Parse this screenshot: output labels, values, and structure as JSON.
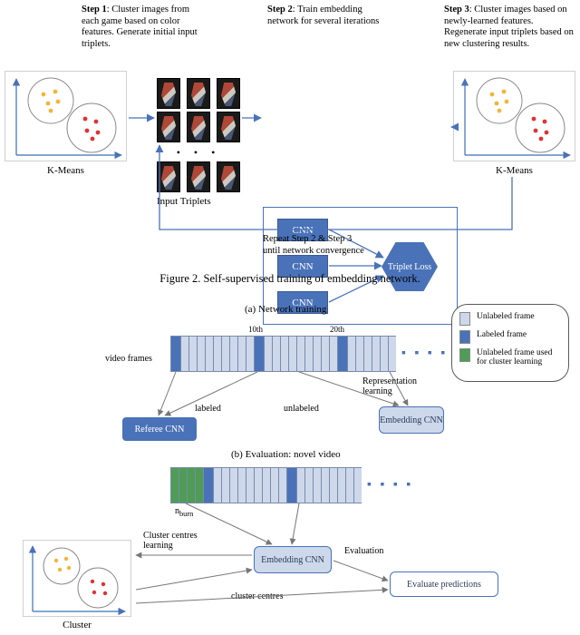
{
  "chart_data": {
    "type": "diagram",
    "title": "Self-supervised training of embedding network.",
    "nodes_top": [
      "K-Means (initial clustering)",
      "Input Triplets",
      "CNN ×3 → Triplet Loss (training box)",
      "K-Means (re-clustering)"
    ],
    "edges_top": [
      [
        "K-Means (initial)",
        "Input Triplets"
      ],
      [
        "Input Triplets",
        "Training box"
      ],
      [
        "Training box",
        "K-Means (re-clustering)"
      ],
      [
        "K-Means (re-clustering)",
        "Input Triplets (feedback)"
      ]
    ],
    "bottom_sections": [
      "(a) Network training",
      "(b) Evaluation: novel video"
    ],
    "nodes_bottom": [
      "video frames (strip a)",
      "Referee CNN",
      "Embedding CNN (training)",
      "video frames (strip b)",
      "Embedding CNN (evaluation)",
      "Cluster (K-Means plot)",
      "Evaluate predictions"
    ],
    "edges_bottom": [
      [
        "strip a labeled frames",
        "Referee CNN",
        "labeled"
      ],
      [
        "strip a unlabeled frames",
        "Embedding CNN (training)",
        "unlabeled / Representation learning"
      ],
      [
        "strip b burn-in frames",
        "Embedding CNN (eval)",
        "n_burn"
      ],
      [
        "Embedding CNN (eval)",
        "Cluster",
        "Cluster centres learning"
      ],
      [
        "Cluster",
        "Embedding CNN (eval)",
        "cluster centres"
      ],
      [
        "Embedding CNN (eval)",
        "Evaluate predictions",
        "Evaluation"
      ]
    ]
  },
  "steps": {
    "s1_title": "Step 1",
    "s1_body": ": Cluster images from each game based on color features. Generate initial input triplets.",
    "s2_title": "Step 2",
    "s2_body": ": Train embedding network for several iterations",
    "s3_title": "Step 3",
    "s3_body": ": Cluster images based on newly-learned features. Regenerate input triplets based on new clustering results."
  },
  "top": {
    "kmeans_label": "K-Means",
    "triplets_label": "Input Triplets",
    "cnn_label": "CNN",
    "triplet_loss_label": "Triplet Loss",
    "feedback_line1": "Repeat Step 2 & Step 3",
    "feedback_line2": "until network convergence"
  },
  "figure_caption": "Figure 2. Self-supervised training of embedding network.",
  "legend": {
    "unlabeled": "Unlabeled frame",
    "labeled": "Labeled frame",
    "burn": "Unlabeled frame used for cluster learning"
  },
  "colors": {
    "unlabeled": "#cdd8eb",
    "labeled": "#4a72b8",
    "burn": "#4f9c56"
  },
  "bottom": {
    "section_a": "(a) Network training",
    "section_b": "(b) Evaluation: novel video",
    "video_frames_label": "video frames",
    "tick10": "10th",
    "tick20": "20th",
    "dots": "● ● ● ●",
    "repr_learning": "Representation learning",
    "labeled_edge": "labeled",
    "unlabeled_edge": "unlabeled",
    "referee_cnn": "Referee CNN",
    "embedding_cnn": "Embedding CNN",
    "n_burn": "n",
    "n_burn_sub": "burn",
    "cluster_centres_learning": "Cluster centres learning",
    "cluster_label": "Cluster",
    "evaluation_edge": "Evaluation",
    "cluster_centres": "cluster centres",
    "evaluate_predictions": "Evaluate predictions"
  }
}
